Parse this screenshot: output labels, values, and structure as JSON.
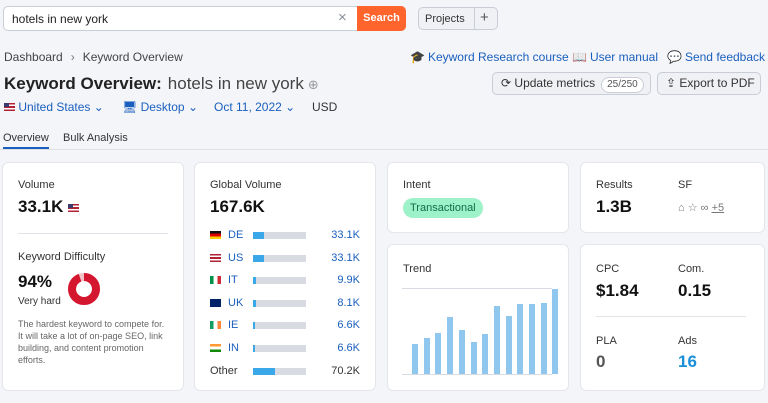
{
  "search": {
    "query": "hotels in new york",
    "clear_icon": "close-icon",
    "button": "Search"
  },
  "projects": {
    "label": "Projects",
    "add": "+"
  },
  "breadcrumb": {
    "home": "Dashboard",
    "chevron": "›",
    "current": "Keyword Overview"
  },
  "links": {
    "course": "Keyword Research course",
    "manual": "User manual",
    "feedback": "Send feedback"
  },
  "header": {
    "title": "Keyword Overview:",
    "keyword": "hotels in new york",
    "add_icon": "⊕"
  },
  "buttons": {
    "update": "Update metrics",
    "update_count": "25/250",
    "export": "Export to PDF"
  },
  "filters": {
    "country": "United States",
    "device": "Desktop",
    "date": "Oct 11, 2022",
    "currency": "USD"
  },
  "tabs": [
    "Overview",
    "Bulk Analysis"
  ],
  "volume": {
    "label": "Volume",
    "value": "33.1K"
  },
  "difficulty": {
    "label": "Keyword Difficulty",
    "value": "94%",
    "level": "Very hard",
    "percent": 94,
    "description": "The hardest keyword to compete for. It will take a lot of on-page SEO, link building, and content promotion efforts."
  },
  "global_volume": {
    "label": "Global Volume",
    "value": "167.6K",
    "rows": [
      {
        "code": "DE",
        "value": "33.1K",
        "share": 0.2
      },
      {
        "code": "US",
        "value": "33.1K",
        "share": 0.2
      },
      {
        "code": "IT",
        "value": "9.9K",
        "share": 0.06
      },
      {
        "code": "UK",
        "value": "8.1K",
        "share": 0.05
      },
      {
        "code": "IE",
        "value": "6.6K",
        "share": 0.04
      },
      {
        "code": "IN",
        "value": "6.6K",
        "share": 0.04
      },
      {
        "code": "Other",
        "value": "70.2K",
        "share": 0.42
      }
    ]
  },
  "intent": {
    "label": "Intent",
    "value": "Transactional"
  },
  "trend": {
    "label": "Trend",
    "values": [
      0.35,
      0.42,
      0.48,
      0.67,
      0.52,
      0.38,
      0.47,
      0.8,
      0.68,
      0.82,
      0.82,
      0.84,
      1.0
    ]
  },
  "results": {
    "label": "Results",
    "value": "1.3B",
    "sf_label": "SF",
    "sf_more": "+5"
  },
  "cpc": {
    "label": "CPC",
    "value": "$1.84"
  },
  "com": {
    "label": "Com.",
    "value": "0.15"
  },
  "pla": {
    "label": "PLA",
    "value": "0"
  },
  "ads": {
    "label": "Ads",
    "value": "16"
  },
  "colors": {
    "accent": "#ff642d",
    "link": "#1a5fbd",
    "bar": "#8fc7ee",
    "difficulty": "#d5162f",
    "intent_bg": "#9ef2c9"
  }
}
